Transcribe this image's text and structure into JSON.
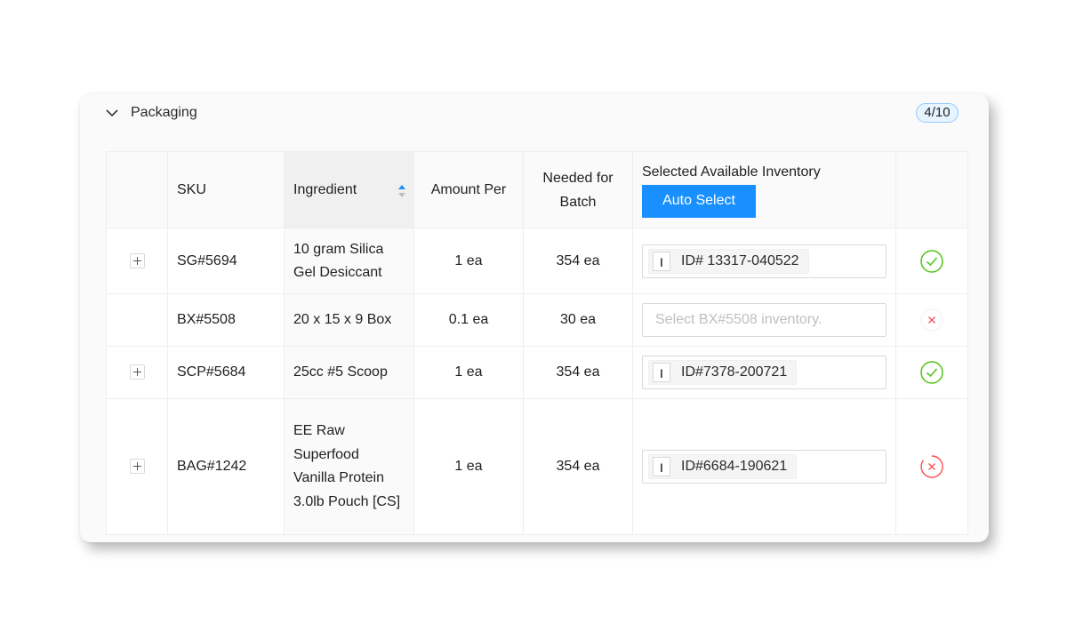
{
  "panel": {
    "title": "Packaging",
    "count": "4/10"
  },
  "table": {
    "columns": {
      "sku": "SKU",
      "ingredient": "Ingredient",
      "amount_per": "Amount Per",
      "needed": "Needed for Batch",
      "inventory": "Selected Available Inventory"
    },
    "auto_select_label": "Auto Select",
    "rows": [
      {
        "sku": "SG#5694",
        "ingredient": "10 gram Silica Gel Desiccant",
        "amount_per": "1 ea",
        "needed": "354 ea",
        "tag_icon": "I",
        "inventory": "ID# 13317-040522",
        "status": "ok"
      },
      {
        "sku": "BX#5508",
        "ingredient": "20 x 15 x 9 Box",
        "amount_per": "0.1 ea",
        "needed": "30 ea",
        "placeholder": "Select BX#5508 inventory.",
        "status": "error"
      },
      {
        "sku": "SCP#5684",
        "ingredient": "25cc #5 Scoop",
        "amount_per": "1 ea",
        "needed": "354 ea",
        "tag_icon": "I",
        "inventory": "ID#7378-200721",
        "status": "ok"
      },
      {
        "sku": "BAG#1242",
        "ingredient": "EE Raw Superfood Vanilla Protein 3.0lb Pouch [CS]",
        "amount_per": "1 ea",
        "needed": "354 ea",
        "tag_icon": "I",
        "inventory": "ID#6684-190621",
        "status": "error"
      }
    ]
  },
  "colors": {
    "primary": "#1890ff",
    "success": "#52c41a",
    "error": "#ff4d4f"
  }
}
